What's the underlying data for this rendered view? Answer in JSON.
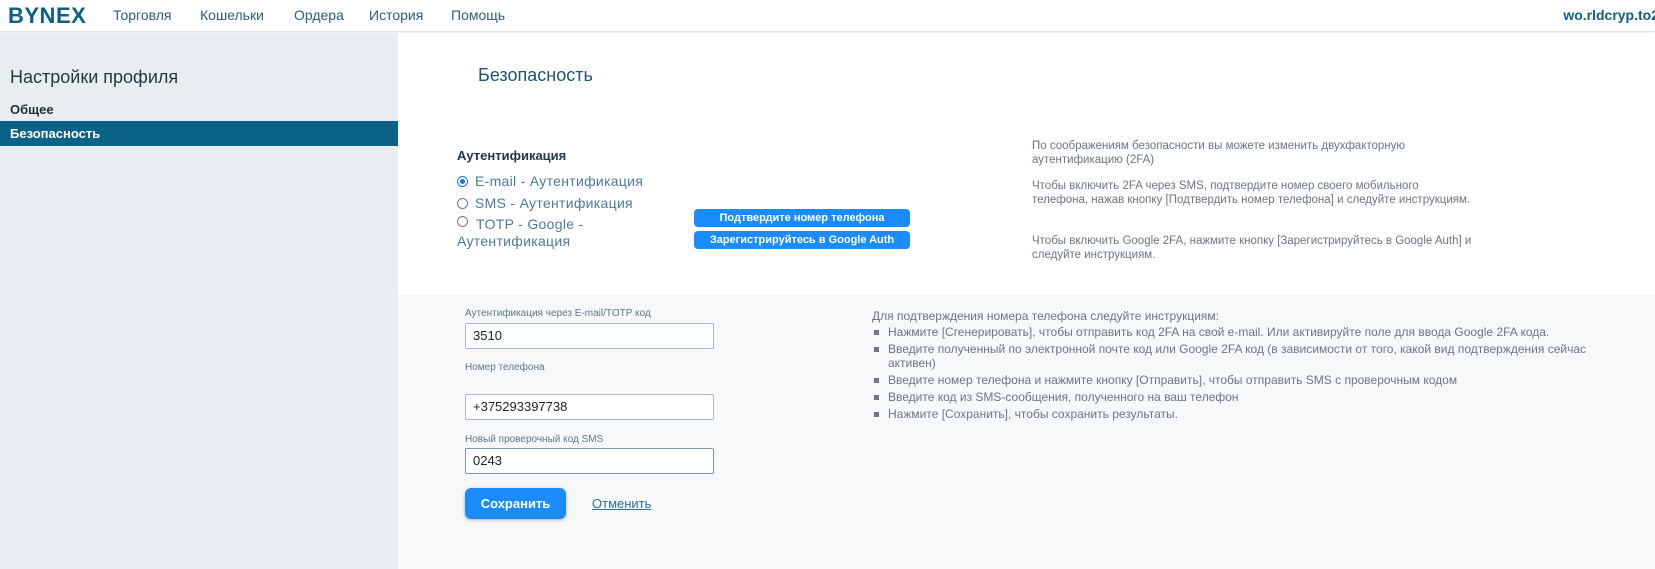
{
  "header": {
    "logo": "BYNEX",
    "nav": [
      "Торговля",
      "Кошельки",
      "Ордера",
      "История",
      "Помощь"
    ],
    "user": "wo.rldcryp.to2"
  },
  "sidebar": {
    "title": "Настройки профиля",
    "items": [
      {
        "label": "Общее",
        "active": false
      },
      {
        "label": "Безопасность",
        "active": true
      }
    ]
  },
  "main": {
    "title": "Безопасность",
    "auth": {
      "heading": "Аутентификация",
      "options": [
        {
          "label": "E-mail - Аутентификация",
          "checked": true
        },
        {
          "label": "SMS - Аутентификация",
          "checked": false
        },
        {
          "label": "TOTP - Google - Аутентификация",
          "checked": false
        }
      ],
      "confirm_phone_button": "Подтвердите номер телефона",
      "google_auth_button": "Зарегистрируйтесь в Google Auth"
    },
    "info": [
      "По соображениям безопасности вы можете изменить двухфакторную аутентификацию (2FA)",
      "Чтобы включить 2FA через SMS, подтвердите номер своего мобильного телефона, нажав кнопку [Подтвердить номер телефона] и следуйте инструкциям.",
      "Чтобы включить Google 2FA, нажмите кнопку [Зарегистрируйтесь в Google Auth] и следуйте инструкциям."
    ],
    "form": {
      "code_label": "Аутентификация через E-mail/TOTP код",
      "code_value": "3510",
      "phone_label": "Номер телефона",
      "phone_value": "+375293397738",
      "sms_label": "Новый проверочный код SMS",
      "sms_value": "0243",
      "save": "Сохранить",
      "cancel": "Отменить"
    },
    "instructions": {
      "title": "Для подтверждения номера телефона следуйте инструкциям:",
      "items": [
        "Нажмите [Сгенерировать], чтобы отправить код 2FA на свой e-mail. Или активируйте поле для ввода Google 2FA кода.",
        "Введите полученный по электронной почте код или Google 2FA код (в зависимости от того, какой вид подтверждения сейчас активен)",
        "Введите номер телефона и нажмите кнопку [Отправить], чтобы отправить SMS с проверочным кодом",
        "Введите код из SMS-сообщения, полученного на ваш телефон",
        "Нажмите [Сохранить], чтобы сохранить результаты."
      ]
    }
  }
}
